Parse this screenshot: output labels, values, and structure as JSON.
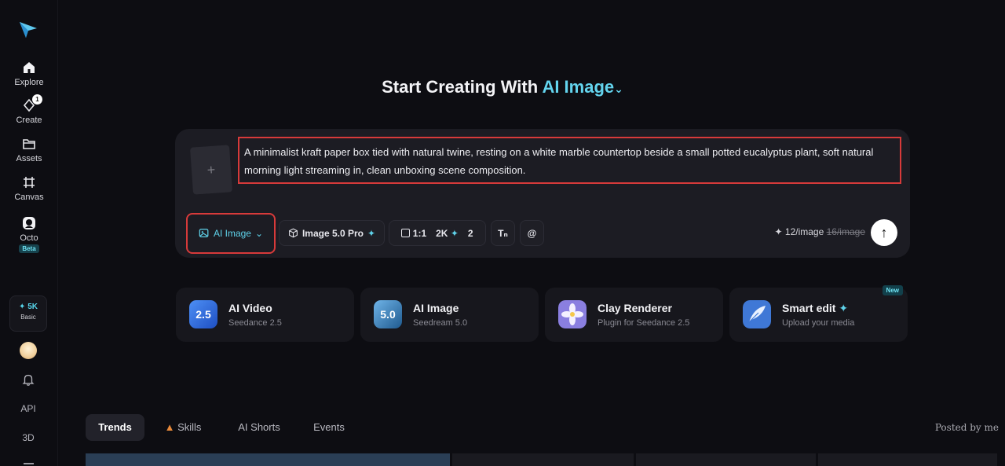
{
  "sidebar": {
    "items": [
      {
        "label": "Explore"
      },
      {
        "label": "Create",
        "badge": "1"
      },
      {
        "label": "Assets"
      },
      {
        "label": "Canvas"
      },
      {
        "label": "Octo",
        "tag": "Beta"
      }
    ],
    "credits": {
      "amount": "5K",
      "plan": "Basic"
    },
    "bottom": {
      "api": "API",
      "threed": "3D"
    }
  },
  "title": {
    "prefix": "Start Creating With",
    "accent": "AI Image"
  },
  "prompt": {
    "text": "A minimalist kraft paper box tied with natural twine, resting on a white marble countertop beside a small potted eucalyptus plant, soft natural morning light streaming in, clean unboxing scene composition."
  },
  "toolbar": {
    "mode": "AI Image",
    "model": "Image 5.0 Pro",
    "ratio": "1:1",
    "resolution": "2K",
    "count": "2",
    "cost": "12/image",
    "old_cost": "16/image"
  },
  "tools": [
    {
      "name": "AI Video",
      "sub": "Seedance 2.5",
      "icon_text": "2.5"
    },
    {
      "name": "AI Image",
      "sub": "Seedream 5.0",
      "icon_text": "5.0"
    },
    {
      "name": "Clay Renderer",
      "sub": "Plugin for Seedance 2.5"
    },
    {
      "name": "Smart edit",
      "sub": "Upload your media",
      "tag": "New"
    }
  ],
  "tabs": [
    "Trends",
    "Skills",
    "AI Shorts",
    "Events"
  ],
  "posted_by": "Posted by me",
  "colors": {
    "accent": "#63d4ee",
    "highlight": "#d73a3a",
    "background": "#0d0d12"
  }
}
